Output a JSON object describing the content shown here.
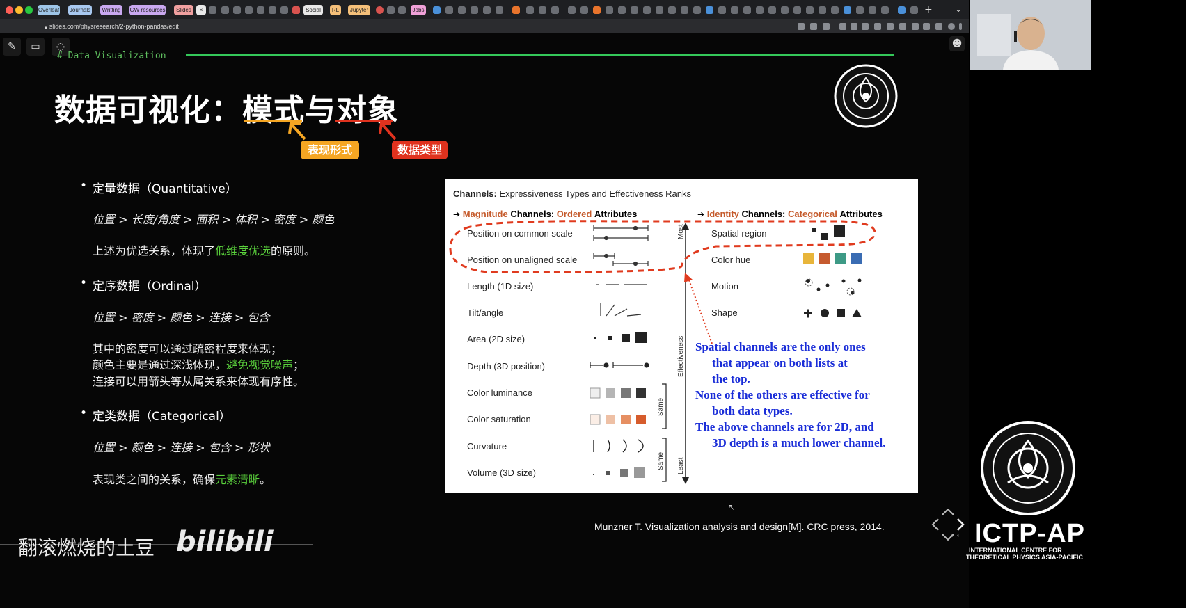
{
  "browser": {
    "tabs": [
      "Overleaf",
      "Journals",
      "Writting",
      "GW resources",
      "Slides",
      "Social",
      "RL",
      "Jupyter",
      "Jobs"
    ],
    "url": "slides.com/physresearch/2-python-pandas/edit"
  },
  "slide": {
    "code_header": "# Data Visualization",
    "title": "数据可视化：模式与对象",
    "tag_form": "表现形式",
    "tag_type": "数据类型",
    "sections": [
      {
        "heading": "定量数据（Quantitative）",
        "order": "位置 > 长度/角度 > 面积 > 体积 > 密度 > 颜色",
        "note_pre": "上述为优选关系，体现了",
        "note_hl": "低维度优选",
        "note_post": "的原则。"
      },
      {
        "heading": "定序数据（Ordinal）",
        "order": "位置 > 密度 > 颜色 > 连接 > 包含",
        "note1": "其中的密度可以通过疏密程度来体现；",
        "note2_pre": "颜色主要是通过深浅体现，",
        "note2_hl": "避免视觉噪声",
        "note2_post": "；",
        "note3": "连接可以用箭头等从属关系来体现有序性。"
      },
      {
        "heading": "定类数据（Categorical）",
        "order": "位置 > 颜色 > 连接 > 包含 > 形状",
        "note_pre": "表现类之间的关系，确保",
        "note_hl": "元素清晰",
        "note_post": "。"
      }
    ],
    "citation": "Munzner T. Visualization analysis and design[M]. CRC press, 2014.",
    "watermark": "翻滚燃烧的土豆",
    "bilibili": "bilibili",
    "ictp": "ICTP-AP",
    "ictp_sub1": "INTERNATIONAL CENTRE FOR",
    "ictp_sub2": "THEORETICAL PHYSICS ASIA-PACIFIC",
    "slide_number": "4 · 4"
  },
  "figure": {
    "title_bold": "Channels:",
    "title_rest": "Expressiveness Types and Effectiveness Ranks",
    "left_head": [
      "Magnitude",
      "Channels:",
      "Ordered",
      "Attributes"
    ],
    "right_head": [
      "Identity",
      "Channels:",
      "Categorical",
      "Attributes"
    ],
    "magnitude": [
      "Position on common scale",
      "Position on unaligned scale",
      "Length (1D size)",
      "Tilt/angle",
      "Area (2D size)",
      "Depth (3D position)",
      "Color luminance",
      "Color saturation",
      "Curvature",
      "Volume (3D size)"
    ],
    "identity": [
      "Spatial region",
      "Color hue",
      "Motion",
      "Shape"
    ],
    "axis_most": "Most",
    "axis_effectiveness": "Effectiveness",
    "axis_least": "Least",
    "same": "Same",
    "annotation": [
      "Spatial channels are the only ones",
      "that appear on both lists at",
      "the top.",
      "None of the others are effective for",
      "both data types.",
      "The above channels are for 2D, and",
      "3D depth is a much lower channel."
    ],
    "colors": {
      "orange": "#c55a2b",
      "annotation_blue": "#1a2dd8",
      "dash_red": "#e03b1f"
    }
  },
  "colors": {
    "tag_orange": "#f5a623",
    "tag_red": "#e0321e",
    "green": "#34c759"
  }
}
